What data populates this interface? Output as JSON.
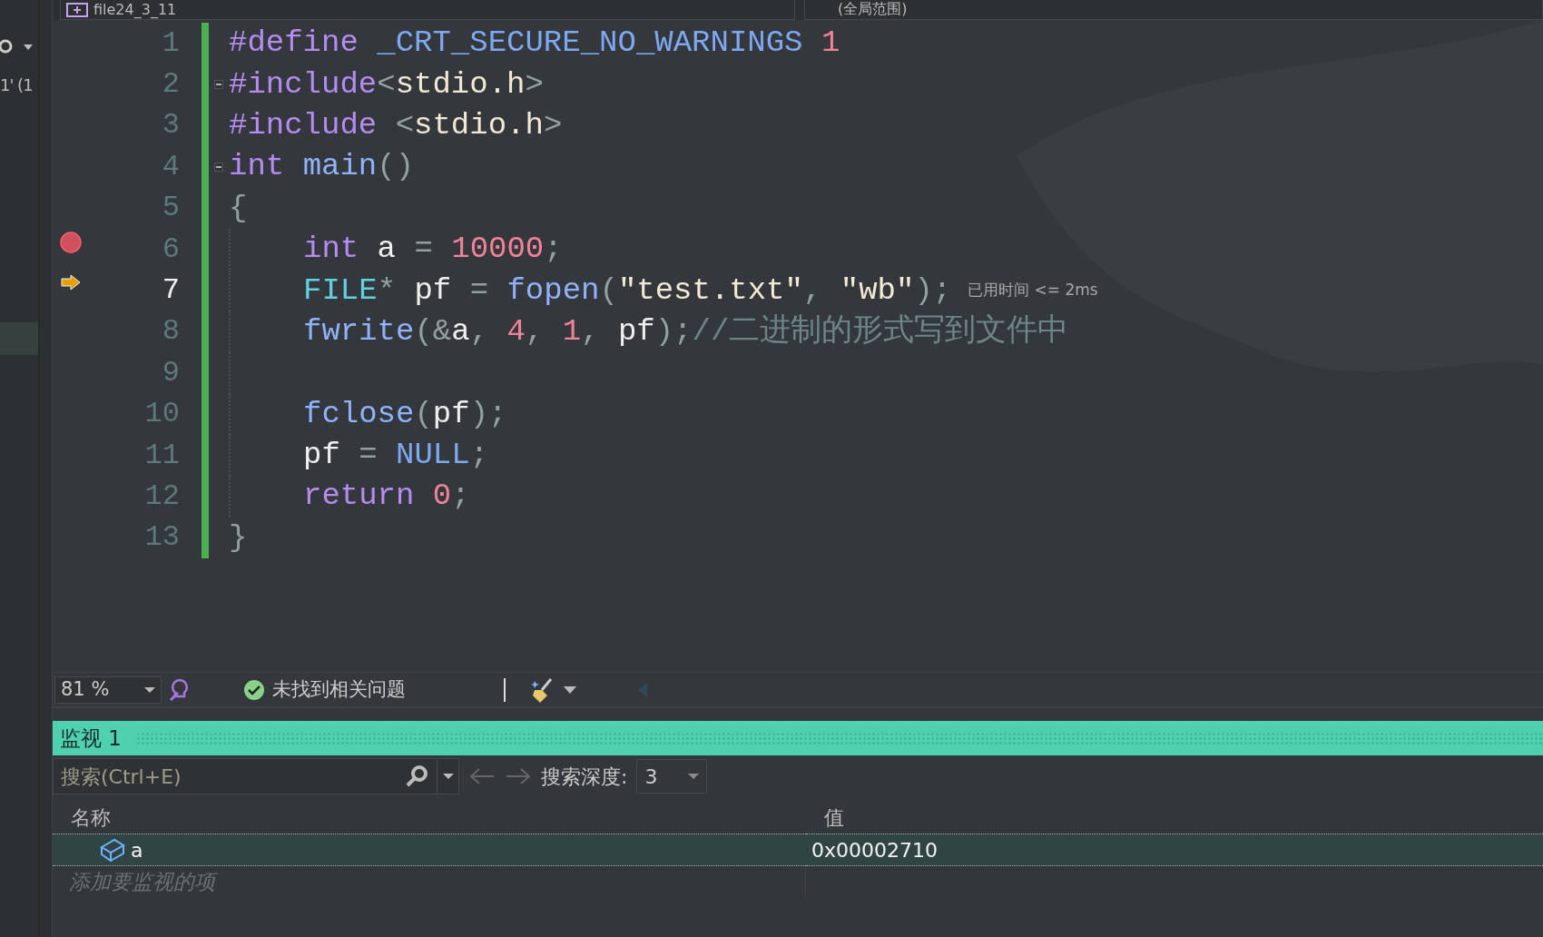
{
  "tab_bar": {
    "file_tab": "file24_3_11",
    "scope": "(全局范围)"
  },
  "side_panel": {
    "text": "1' (1"
  },
  "code_lines": [
    {
      "number": "1",
      "fold": false,
      "indent": false,
      "breakpoint": false,
      "current": false,
      "tokens": [
        {
          "kind": "keyword",
          "text": "#define "
        },
        {
          "kind": "macro",
          "text": "_CRT_SECURE_NO_WARNINGS "
        },
        {
          "kind": "number",
          "text": "1"
        }
      ]
    },
    {
      "number": "2",
      "fold": true,
      "indent": false,
      "breakpoint": false,
      "current": false,
      "tokens": [
        {
          "kind": "keyword",
          "text": "#include"
        },
        {
          "kind": "punct",
          "text": "<"
        },
        {
          "kind": "header",
          "text": "stdio.h"
        },
        {
          "kind": "punct",
          "text": ">"
        }
      ]
    },
    {
      "number": "3",
      "fold": false,
      "indent": false,
      "breakpoint": false,
      "current": false,
      "tokens": [
        {
          "kind": "keyword",
          "text": "#include "
        },
        {
          "kind": "punct",
          "text": "<"
        },
        {
          "kind": "header",
          "text": "stdio.h"
        },
        {
          "kind": "punct",
          "text": ">"
        }
      ]
    },
    {
      "number": "4",
      "fold": true,
      "indent": false,
      "breakpoint": false,
      "current": false,
      "tokens": [
        {
          "kind": "keyword",
          "text": "int "
        },
        {
          "kind": "function",
          "text": "main"
        },
        {
          "kind": "punct",
          "text": "()"
        }
      ]
    },
    {
      "number": "5",
      "fold": false,
      "indent": false,
      "breakpoint": false,
      "current": false,
      "tokens": [
        {
          "kind": "punct",
          "text": "{"
        }
      ]
    },
    {
      "number": "6",
      "fold": false,
      "indent": true,
      "breakpoint": true,
      "current": false,
      "tokens": [
        {
          "kind": "keyword",
          "text": "int"
        },
        {
          "kind": "plain",
          "text": " a "
        },
        {
          "kind": "punct",
          "text": "="
        },
        {
          "kind": "number",
          "text": " 10000"
        },
        {
          "kind": "punct",
          "text": ";"
        }
      ]
    },
    {
      "number": "7",
      "fold": false,
      "indent": true,
      "breakpoint": false,
      "current": true,
      "hint": "已用时间 <= 2ms",
      "tokens": [
        {
          "kind": "type",
          "text": "FILE"
        },
        {
          "kind": "punct",
          "text": "*"
        },
        {
          "kind": "plain",
          "text": " pf "
        },
        {
          "kind": "punct",
          "text": "="
        },
        {
          "kind": "function",
          "text": " fopen"
        },
        {
          "kind": "punct",
          "text": "("
        },
        {
          "kind": "string",
          "text": "\"test.txt\""
        },
        {
          "kind": "punct",
          "text": ", "
        },
        {
          "kind": "string",
          "text": "\"wb\""
        },
        {
          "kind": "punct",
          "text": ");"
        }
      ]
    },
    {
      "number": "8",
      "fold": false,
      "indent": true,
      "breakpoint": false,
      "current": false,
      "tokens": [
        {
          "kind": "function",
          "text": "fwrite"
        },
        {
          "kind": "punct",
          "text": "(&"
        },
        {
          "kind": "plain",
          "text": "a"
        },
        {
          "kind": "punct",
          "text": ", "
        },
        {
          "kind": "number",
          "text": "4"
        },
        {
          "kind": "punct",
          "text": ", "
        },
        {
          "kind": "number",
          "text": "1"
        },
        {
          "kind": "punct",
          "text": ", "
        },
        {
          "kind": "plain",
          "text": "pf"
        },
        {
          "kind": "punct",
          "text": ");"
        },
        {
          "kind": "comment",
          "text": "//二进制的形式写到文件中"
        }
      ]
    },
    {
      "number": "9",
      "fold": false,
      "indent": true,
      "breakpoint": false,
      "current": false
    },
    {
      "number": "10",
      "fold": false,
      "indent": true,
      "breakpoint": false,
      "current": false,
      "tokens": [
        {
          "kind": "function",
          "text": "fclose"
        },
        {
          "kind": "punct",
          "text": "("
        },
        {
          "kind": "plain",
          "text": "pf"
        },
        {
          "kind": "punct",
          "text": ");"
        }
      ]
    },
    {
      "number": "11",
      "fold": false,
      "indent": true,
      "breakpoint": false,
      "current": false,
      "tokens": [
        {
          "kind": "plain",
          "text": "pf "
        },
        {
          "kind": "punct",
          "text": "="
        },
        {
          "kind": "macro",
          "text": " NULL"
        },
        {
          "kind": "punct",
          "text": ";"
        }
      ]
    },
    {
      "number": "12",
      "fold": false,
      "indent": true,
      "breakpoint": false,
      "current": false,
      "tokens": [
        {
          "kind": "keyword",
          "text": "return "
        },
        {
          "kind": "number",
          "text": "0"
        },
        {
          "kind": "punct",
          "text": ";"
        }
      ]
    },
    {
      "number": "13",
      "fold": false,
      "indent": false,
      "breakpoint": false,
      "current": false,
      "tokens": [
        {
          "kind": "punct",
          "text": "}"
        }
      ]
    }
  ],
  "status_bar": {
    "zoom": "81 %",
    "issues": "未找到相关问题"
  },
  "watch": {
    "title": "监视 1",
    "search": {
      "placeholder": "搜索(Ctrl+E)"
    },
    "depth_label": "搜索深度:",
    "depth": "3",
    "columns": [
      "名称",
      "值"
    ],
    "rows": [
      {
        "name": "a",
        "value": "0x00002710",
        "selected": true
      }
    ],
    "add_placeholder": "添加要监视的项"
  }
}
